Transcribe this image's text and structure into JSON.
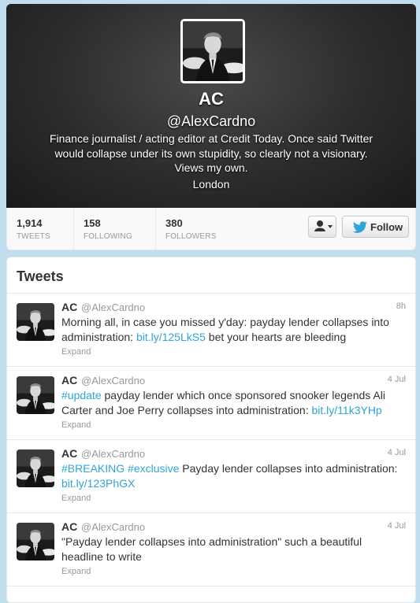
{
  "profile": {
    "name": "AC",
    "handle": "@AlexCardno",
    "bio_line1": "Finance journalist / acting editor at Credit Today. Once said Twitter",
    "bio_line2": "would collapse under its own stupidity, so clearly not a visionary.",
    "bio_line3": "Views my own.",
    "location": "London"
  },
  "stats": [
    {
      "value": "1,914",
      "label": "TWEETS"
    },
    {
      "value": "158",
      "label": "FOLLOWING"
    },
    {
      "value": "380",
      "label": "FOLLOWERS"
    }
  ],
  "actions": {
    "follow_label": "Follow",
    "user_icon": "person-icon",
    "follow_icon": "bird-icon"
  },
  "tweets_section": {
    "title": "Tweets",
    "tweets": [
      {
        "name": "AC",
        "handle": "@AlexCardno",
        "time": "8h",
        "line1_text": "Morning all, in case you missed y'day: payday lender collapses into",
        "line2_pre": "administration: ",
        "link": "bit.ly/125LkS5",
        "line2_post": " bet your hearts are bleeding",
        "expand": "Expand"
      },
      {
        "name": "AC",
        "handle": "@AlexCardno",
        "time": "4 Jul",
        "hashtag1": "#update",
        "line1_text": " payday lender which once sponsored snooker legends Ali",
        "line2_pre": "Carter and Joe Perry collapses into administration: ",
        "link": "bit.ly/11k3YHp",
        "expand": "Expand"
      },
      {
        "name": "AC",
        "handle": "@AlexCardno",
        "time": "4 Jul",
        "hashtag1": "#BREAKING",
        "hashtag2": "#exclusive",
        "line1_text": " Payday lender collapses into administration:",
        "link": "bit.ly/123PhGX",
        "expand": "Expand"
      },
      {
        "name": "AC",
        "handle": "@AlexCardno",
        "time": "4 Jul",
        "line1_text": "\"Payday lender collapses into administration\" such a beautiful",
        "line2_pre": "headline to write",
        "expand": "Expand"
      }
    ]
  },
  "colors": {
    "background": "#c0deed",
    "link": "#2fa4d6",
    "header_dark": "#2c2c2c"
  }
}
